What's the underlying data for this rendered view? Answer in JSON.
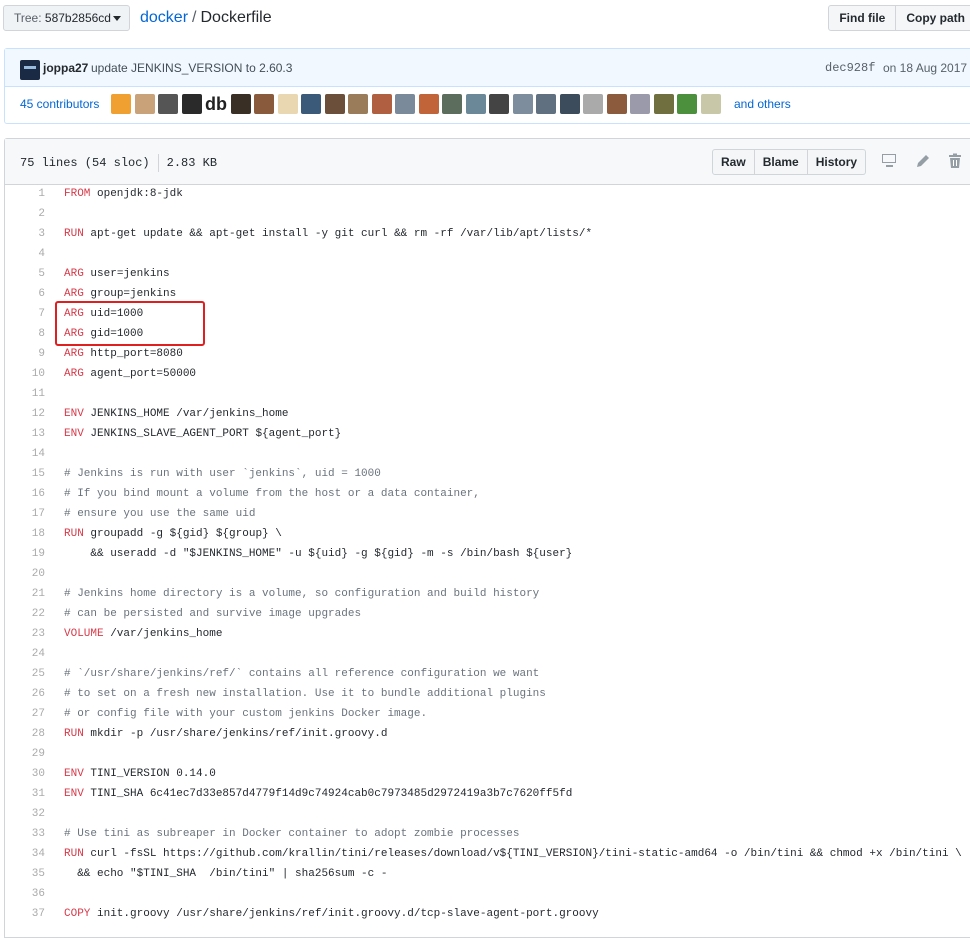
{
  "topbar": {
    "tree_label": "Tree:",
    "tree_value": "587b2856cd",
    "repo": "docker",
    "separator": "/",
    "file": "Dockerfile",
    "find_file": "Find file",
    "copy_path": "Copy path"
  },
  "commit": {
    "author": "joppa27",
    "message": "update JENKINS_VERSION to 2.60.3",
    "sha": "dec928f",
    "date": "on 18 Aug 2017"
  },
  "contributors": {
    "count_label": "45 contributors",
    "others_label": "and others",
    "avatar_colors": [
      "#f0a030",
      "#c9a27a",
      "#555555",
      "#2a2a2a",
      "db",
      "#3a2f25",
      "#8a5a3c",
      "#e8d7b0",
      "#3b5a7a",
      "#6b4f3a",
      "#9a7c5a",
      "#b06040",
      "#7a8a9a",
      "#c2643a",
      "#5d6d5d",
      "#6a8898",
      "#444444",
      "#7d8d9d",
      "#607080",
      "#3c4c5c",
      "#aaaaaa",
      "#8c5a3c",
      "#9a9aaa",
      "#6f6f3f",
      "#4c8f3c",
      "#c8c8a8"
    ]
  },
  "file": {
    "lines_info": "75 lines (54 sloc)",
    "size": "2.83 KB",
    "raw": "Raw",
    "blame": "Blame",
    "history": "History"
  },
  "code_lines": [
    {
      "n": "1",
      "kw": "FROM",
      "rest": " openjdk:8-jdk"
    },
    {
      "n": "2",
      "kw": "",
      "rest": ""
    },
    {
      "n": "3",
      "kw": "RUN",
      "rest": " apt-get update && apt-get install -y git curl && rm -rf /var/lib/apt/lists/*"
    },
    {
      "n": "4",
      "kw": "",
      "rest": ""
    },
    {
      "n": "5",
      "kw": "ARG",
      "rest": " user=jenkins"
    },
    {
      "n": "6",
      "kw": "ARG",
      "rest": " group=jenkins"
    },
    {
      "n": "7",
      "kw": "ARG",
      "rest": " uid=1000"
    },
    {
      "n": "8",
      "kw": "ARG",
      "rest": " gid=1000"
    },
    {
      "n": "9",
      "kw": "ARG",
      "rest": " http_port=8080"
    },
    {
      "n": "10",
      "kw": "ARG",
      "rest": " agent_port=50000"
    },
    {
      "n": "11",
      "kw": "",
      "rest": ""
    },
    {
      "n": "12",
      "kw": "ENV",
      "rest": " JENKINS_HOME /var/jenkins_home"
    },
    {
      "n": "13",
      "kw": "ENV",
      "rest": " JENKINS_SLAVE_AGENT_PORT ${agent_port}"
    },
    {
      "n": "14",
      "kw": "",
      "rest": ""
    },
    {
      "n": "15",
      "cm": "# Jenkins is run with user `jenkins`, uid = 1000"
    },
    {
      "n": "16",
      "cm": "# If you bind mount a volume from the host or a data container,"
    },
    {
      "n": "17",
      "cm": "# ensure you use the same uid"
    },
    {
      "n": "18",
      "kw": "RUN",
      "rest": " groupadd -g ${gid} ${group} \\"
    },
    {
      "n": "19",
      "kw": "",
      "rest": "    && useradd -d \"$JENKINS_HOME\" -u ${uid} -g ${gid} -m -s /bin/bash ${user}"
    },
    {
      "n": "20",
      "kw": "",
      "rest": ""
    },
    {
      "n": "21",
      "cm": "# Jenkins home directory is a volume, so configuration and build history"
    },
    {
      "n": "22",
      "cm": "# can be persisted and survive image upgrades"
    },
    {
      "n": "23",
      "kw": "VOLUME",
      "rest": " /var/jenkins_home"
    },
    {
      "n": "24",
      "kw": "",
      "rest": ""
    },
    {
      "n": "25",
      "cm": "# `/usr/share/jenkins/ref/` contains all reference configuration we want"
    },
    {
      "n": "26",
      "cm": "# to set on a fresh new installation. Use it to bundle additional plugins"
    },
    {
      "n": "27",
      "cm": "# or config file with your custom jenkins Docker image."
    },
    {
      "n": "28",
      "kw": "RUN",
      "rest": " mkdir -p /usr/share/jenkins/ref/init.groovy.d"
    },
    {
      "n": "29",
      "kw": "",
      "rest": ""
    },
    {
      "n": "30",
      "kw": "ENV",
      "rest": " TINI_VERSION 0.14.0"
    },
    {
      "n": "31",
      "kw": "ENV",
      "rest": " TINI_SHA 6c41ec7d33e857d4779f14d9c74924cab0c7973485d2972419a3b7c7620ff5fd"
    },
    {
      "n": "32",
      "kw": "",
      "rest": ""
    },
    {
      "n": "33",
      "cm": "# Use tini as subreaper in Docker container to adopt zombie processes"
    },
    {
      "n": "34",
      "kw": "RUN",
      "rest": " curl -fsSL https://github.com/krallin/tini/releases/download/v${TINI_VERSION}/tini-static-amd64 -o /bin/tini && chmod +x /bin/tini \\"
    },
    {
      "n": "35",
      "kw": "",
      "rest": "  && echo \"$TINI_SHA  /bin/tini\" | sha256sum -c -"
    },
    {
      "n": "36",
      "kw": "",
      "rest": ""
    },
    {
      "n": "37",
      "kw": "COPY",
      "rest": " init.groovy /usr/share/jenkins/ref/init.groovy.d/tcp-slave-agent-port.groovy"
    }
  ],
  "colors": {
    "keyword": "#d73a49",
    "comment": "#6a737d",
    "link": "#0366d6",
    "highlight_border": "#e02020"
  }
}
